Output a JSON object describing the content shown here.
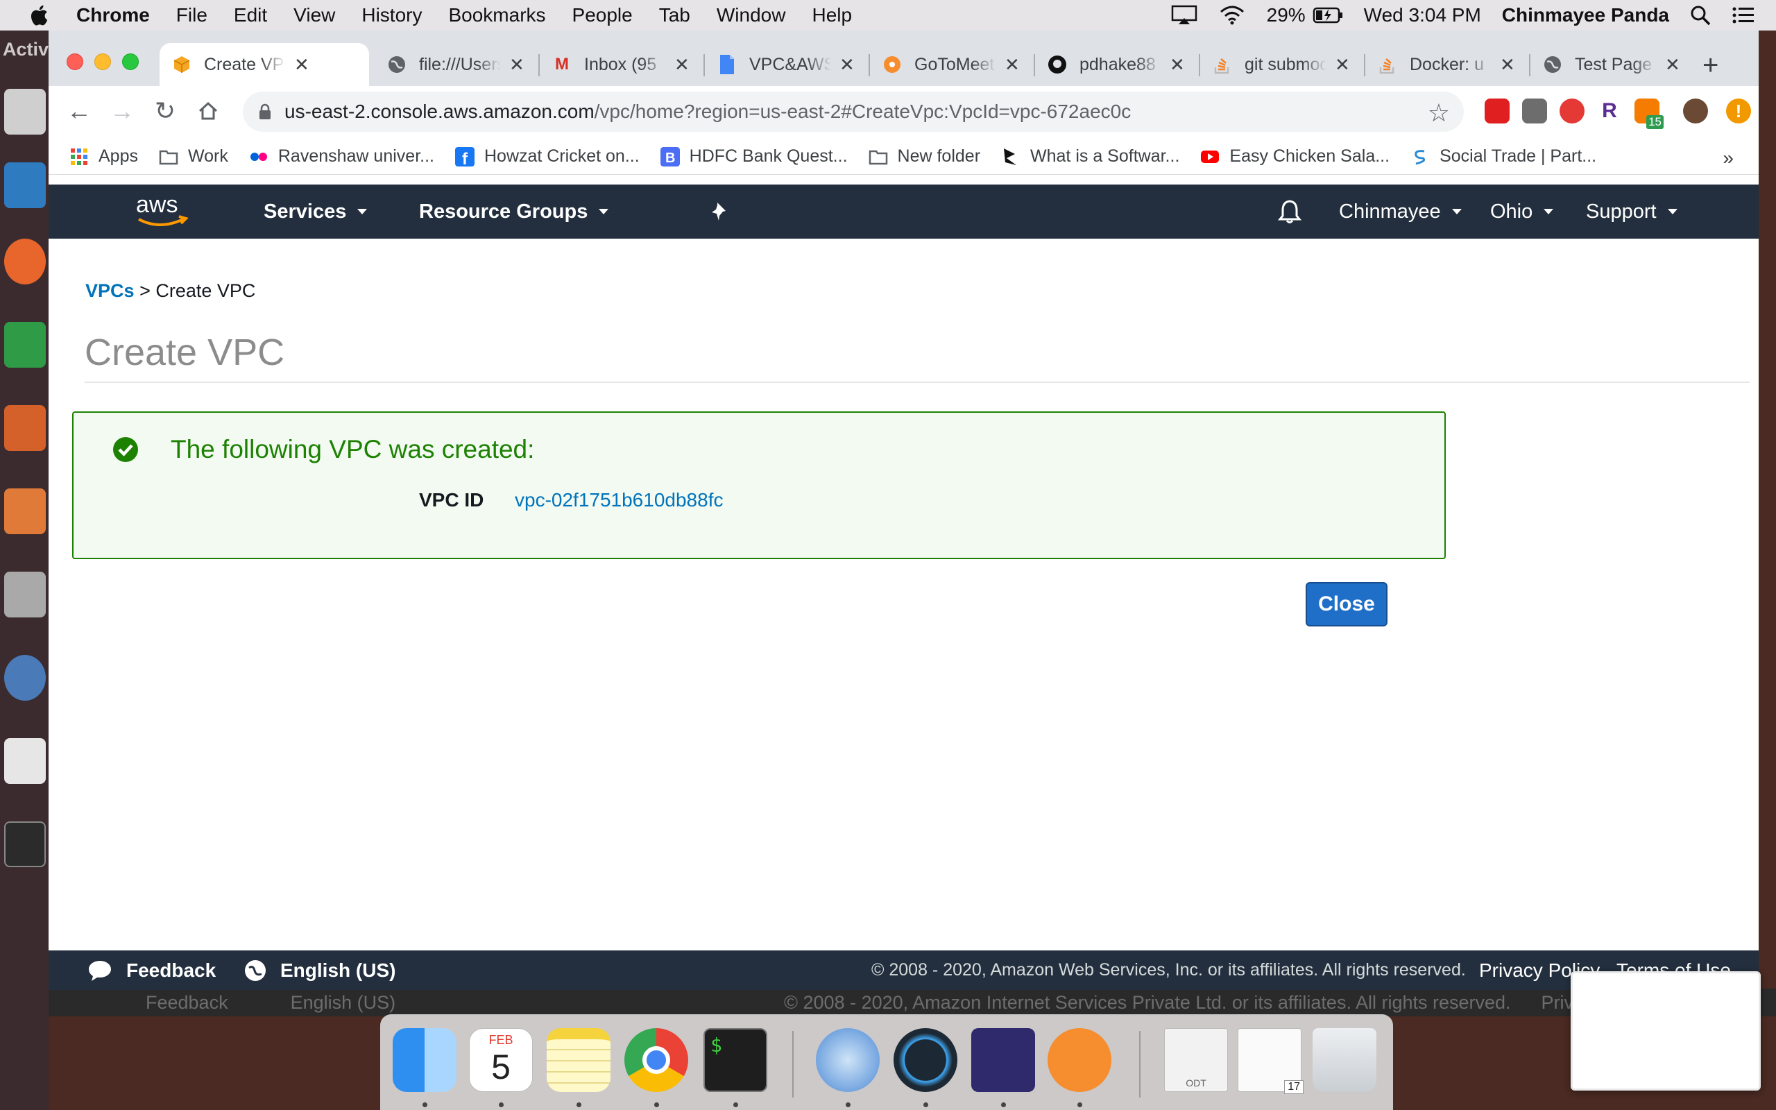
{
  "menubar": {
    "app_name": "Chrome",
    "items": [
      "File",
      "Edit",
      "View",
      "History",
      "Bookmarks",
      "People",
      "Tab",
      "Window",
      "Help"
    ],
    "battery": "29%",
    "clock": "Wed 3:04 PM",
    "user": "Chinmayee Panda"
  },
  "ubuntu": {
    "activities": "Activ"
  },
  "tabs": [
    {
      "label": "Create VPC",
      "icon": "aws-cube-icon",
      "active": true
    },
    {
      "label": "file:///Users",
      "icon": "globe-icon"
    },
    {
      "label": "Inbox (95",
      "icon": "gmail-icon"
    },
    {
      "label": "VPC&AWS",
      "icon": "docs-icon"
    },
    {
      "label": "GoToMeeting",
      "icon": "gotomeeting-icon"
    },
    {
      "label": "pdhake88",
      "icon": "github-icon"
    },
    {
      "label": "git submodule",
      "icon": "stackoverflow-icon"
    },
    {
      "label": "Docker: u",
      "icon": "stackoverflow-icon"
    },
    {
      "label": "Test Page",
      "icon": "globe-icon"
    }
  ],
  "address": {
    "host": "us-east-2.console.aws.amazon.com",
    "path": "/vpc/home?region=us-east-2#CreateVpc:VpcId=vpc-672aec0c"
  },
  "bookmarks": {
    "items": [
      {
        "label": "Apps",
        "color": "#ea4335"
      },
      {
        "label": "Work",
        "color": "#5f6368"
      },
      {
        "label": "Ravenshaw univer...",
        "color": "#e60012"
      },
      {
        "label": "Howzat Cricket on...",
        "color": "#1877f2"
      },
      {
        "label": "HDFC Bank Quest...",
        "color": "#4c6ef5"
      },
      {
        "label": "New folder",
        "color": "#5f6368"
      },
      {
        "label": "What is a Softwar...",
        "color": "#111111"
      },
      {
        "label": "Easy Chicken Sala...",
        "color": "#ff0000"
      },
      {
        "label": "Social Trade | Part...",
        "color": "#2a8ad4"
      }
    ],
    "more": "»"
  },
  "aws_nav": {
    "logo": "aws",
    "services": "Services",
    "resource_groups": "Resource Groups",
    "account": "Chinmayee",
    "region": "Ohio",
    "support": "Support"
  },
  "breadcrumb": {
    "link": "VPCs",
    "separator": ">",
    "current": "Create VPC"
  },
  "page": {
    "title": "Create VPC",
    "success_message": "The following VPC was created:",
    "vpc_id_label": "VPC ID",
    "vpc_id_value": "vpc-02f1751b610db88fc",
    "close_button": "Close"
  },
  "footer": {
    "feedback": "Feedback",
    "language": "English (US)",
    "copyright": "© 2008 - 2020, Amazon Web Services, Inc. or its affiliates. All rights reserved.",
    "privacy": "Privacy Policy",
    "terms": "Terms of Use"
  },
  "ghost_footer": {
    "feedback": "Feedback",
    "language": "English (US)",
    "copyright": "© 2008 - 2020, Amazon Internet Services Private Ltd. or its affiliates. All rights reserved.",
    "privacy": "Privacy Policy"
  },
  "dock": {
    "calendar_month": "FEB",
    "calendar_day": "5",
    "odt_label": "ODT",
    "preview_badge": "17"
  },
  "extension_badge": "15",
  "colors": {
    "aws_nav": "#232f3e",
    "aws_orange": "#ff9900",
    "success_green": "#1d8102",
    "link_blue": "#0073bb",
    "button_blue": "#1f6fc8"
  }
}
